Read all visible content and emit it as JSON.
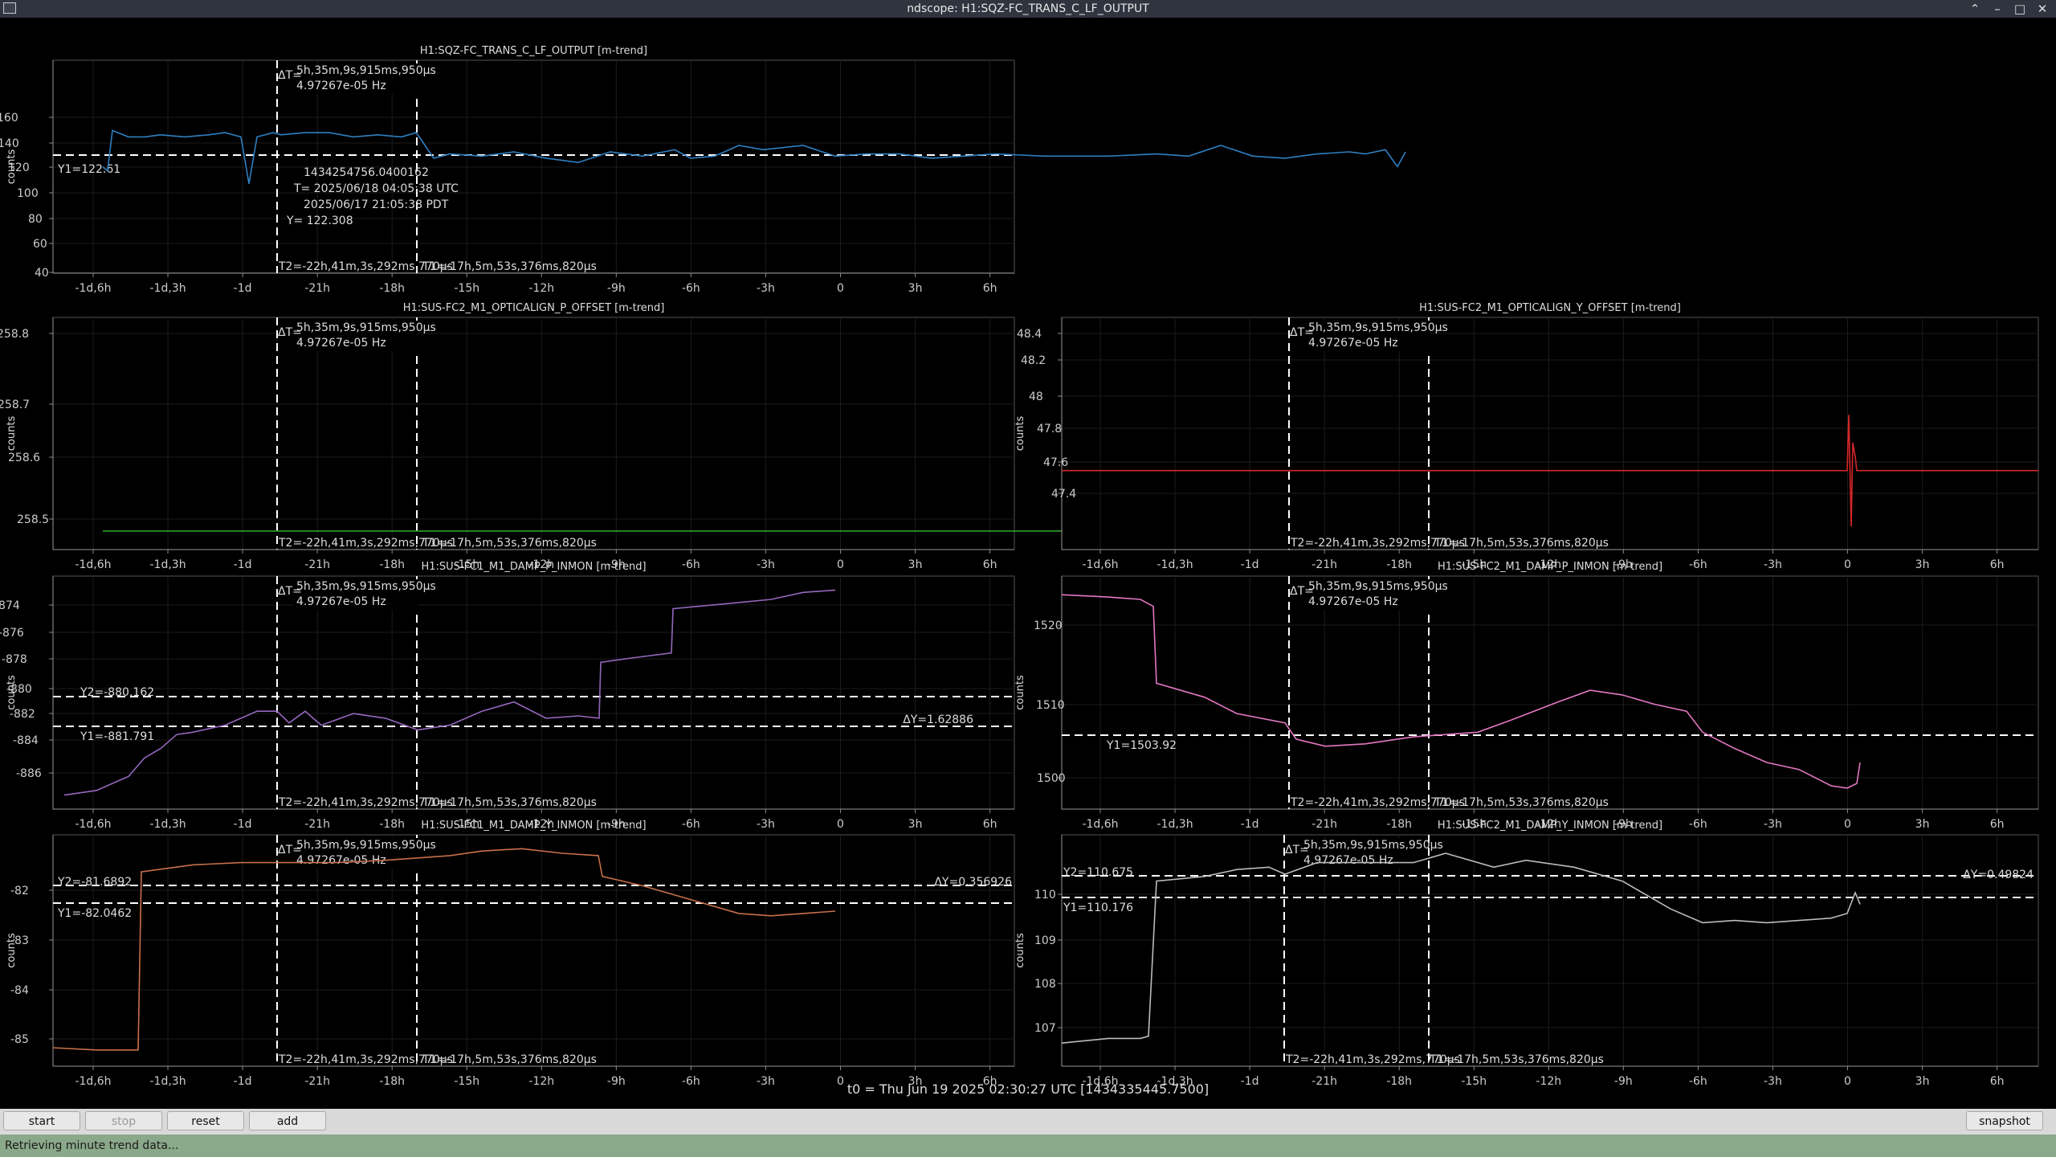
{
  "window": {
    "title": "ndscope: H1:SQZ-FC_TRANS_C_LF_OUTPUT",
    "controls": [
      "⌃",
      "–",
      "□",
      "✕"
    ]
  },
  "cursor_info": {
    "delta_t_label": "ΔT=",
    "delta_t": "5h,35m,9s,915ms,950µs",
    "freq": "4.97267e-05 Hz",
    "t2": "T2=-22h,41m,3s,292ms,770µs",
    "t1": "T1=-17h,5m,53s,376ms,820µs"
  },
  "x_ticks": [
    "-1d,6h",
    "-1d,3h",
    "-1d",
    "-21h",
    "-18h",
    "-15h",
    "-12h",
    "-9h",
    "-6h",
    "-3h",
    "0",
    "3h",
    "6h"
  ],
  "ylabel": "counts",
  "plots": [
    {
      "title": "H1:SQZ-FC_TRANS_C_LF_OUTPUT [m-trend]",
      "yticks": [
        "160",
        "140",
        "120",
        "100",
        "80",
        "60",
        "40"
      ],
      "y1": "Y1=122.61",
      "point_info": [
        "1434254756.0400162",
        "T= 2025/06/18 04:05:38 UTC",
        "2025/06/17 21:05:38 PDT",
        "Y= 122.308"
      ],
      "color": "#2f7fc1"
    },
    {
      "title": "H1:SUS-FC2_M1_OPTICALIGN_P_OFFSET [m-trend]",
      "yticks": [
        "258.8",
        "258.7",
        "258.6",
        "258.5"
      ],
      "color": "#2ca02c"
    },
    {
      "title": "H1:SUS-FC2_M1_OPTICALIGN_Y_OFFSET [m-trend]",
      "yticks": [
        "48.4",
        "48.2",
        "48",
        "47.8",
        "47.6",
        "47.4"
      ],
      "color": "#d62728"
    },
    {
      "title": "H1:SUS-FC1_M1_DAMP_P_INMON [m-trend]",
      "yticks": [
        "-874",
        "-876",
        "-878",
        "-880",
        "-882",
        "-884",
        "-886"
      ],
      "y1": "Y1=-881.791",
      "y2": "Y2=-880.162",
      "dy": "ΔY=1.62886",
      "color": "#9467bd"
    },
    {
      "title": "H1:SUS-FC2_M1_DAMP_P_INMON [m-trend]",
      "yticks": [
        "1520",
        "1510",
        "1500"
      ],
      "y1": "Y1=1503.92",
      "color": "#e377c2"
    },
    {
      "title": "H1:SUS-FC1_M1_DAMP_Y_INMON [m-trend]",
      "yticks": [
        "-82",
        "-83",
        "-84",
        "-85"
      ],
      "y1": "Y1=-82.0462",
      "y2": "Y2=-81.6892",
      "dy": "ΔY=0.356926",
      "color": "#c8704a"
    },
    {
      "title": "H1:SUS-FC2_M1_DAMP_Y_INMON [m-trend]",
      "yticks": [
        "110",
        "109",
        "108",
        "107"
      ],
      "y1": "Y1=110.176",
      "y2": "Y2=110.675",
      "dy": "ΔY=0.49824",
      "color": "#bbbbbb"
    }
  ],
  "t0_label": "t0 = Thu Jun 19 2025 02:30:27 UTC [1434335445.7500]",
  "toolbar": {
    "start_online": "start online",
    "stop_online": "stop online",
    "reset": "reset",
    "add_channels": "add channels",
    "snapshot": "snapshot"
  },
  "status": "Retrieving minute trend data..."
}
